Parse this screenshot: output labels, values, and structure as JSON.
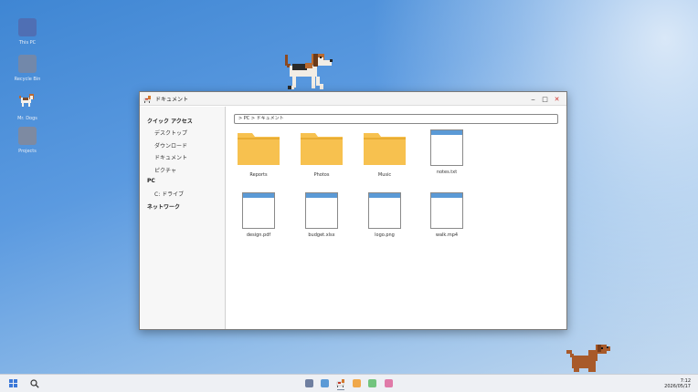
{
  "desktop": {
    "icons": [
      {
        "label": "This PC",
        "color": "#4f6fb4"
      },
      {
        "label": "Recycle Bin",
        "color": "#7288aa"
      },
      {
        "label": "Mr. Dogs",
        "color": ""
      },
      {
        "label": "Projects",
        "color": "#7d8aa2"
      }
    ]
  },
  "window": {
    "title": "ドキュメント",
    "controls": {
      "minimize": "‒",
      "maximize": "□",
      "close": "✕"
    }
  },
  "sidebar": {
    "quick_access": "クイック アクセス",
    "items": [
      "デスクトップ",
      "ダウンロード",
      "ドキュメント",
      "ピクチャ"
    ],
    "pc": "PC",
    "drive": "C: ドライブ",
    "network": "ネットワーク"
  },
  "address": {
    "path": "> PC > ドキュメント"
  },
  "files": [
    {
      "name": "Reports",
      "type": "folder"
    },
    {
      "name": "Photos",
      "type": "folder"
    },
    {
      "name": "Music",
      "type": "folder"
    },
    {
      "name": "notes.txt",
      "type": "file"
    },
    {
      "name": "design.pdf",
      "type": "file"
    },
    {
      "name": "budget.xlsx",
      "type": "file"
    },
    {
      "name": "logo.png",
      "type": "file"
    },
    {
      "name": "walk.mp4",
      "type": "file"
    }
  ],
  "taskbar": {
    "apps": [
      {
        "name": "app-1",
        "color": "#6f7fa0"
      },
      {
        "name": "app-2",
        "color": "#5b9ad6"
      },
      {
        "name": "app-4",
        "color": "#f0a84a"
      },
      {
        "name": "app-5",
        "color": "#72c47e"
      },
      {
        "name": "app-6",
        "color": "#e07aa8"
      }
    ],
    "time": "7:12",
    "date": "2026/05/17"
  },
  "colors": {
    "folder": "#f7c14f",
    "folder_dark": "#e9ad33",
    "doc_bar": "#5b9ad6"
  }
}
